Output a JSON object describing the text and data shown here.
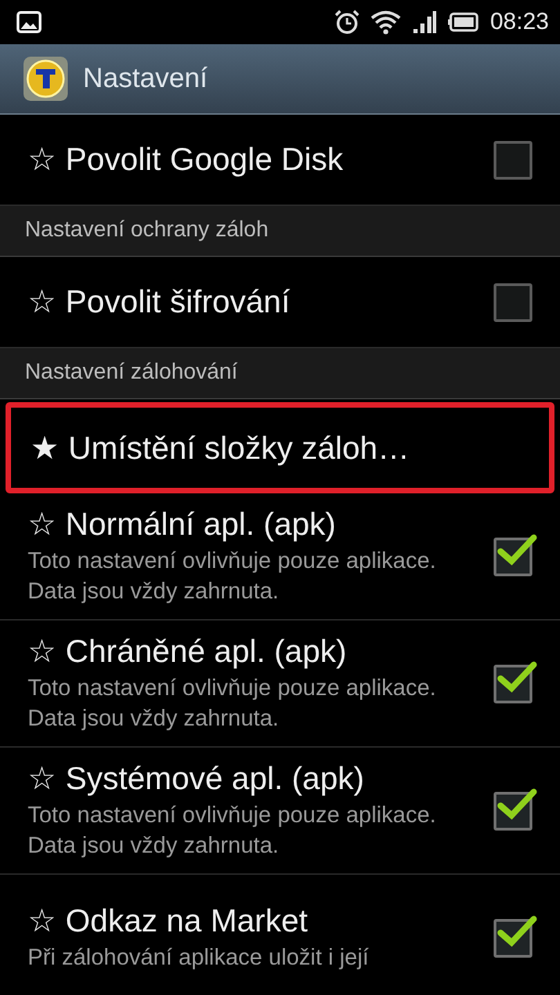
{
  "status_bar": {
    "time": "08:23"
  },
  "action_bar": {
    "title": "Nastavení"
  },
  "items": [
    {
      "kind": "toggle",
      "title": "☆ Povolit Google Disk",
      "highlighted": false,
      "checked": false
    },
    {
      "kind": "category",
      "title": "Nastavení ochrany záloh"
    },
    {
      "kind": "toggle",
      "title": "☆ Povolit šifrování",
      "highlighted": false,
      "checked": false
    },
    {
      "kind": "category",
      "title": "Nastavení zálohování"
    },
    {
      "kind": "link",
      "title": "★ Umístění složky záloh…",
      "highlighted": true
    },
    {
      "kind": "toggle",
      "title": "☆ Normální apl. (apk)",
      "summary": "Toto nastavení ovlivňuje pouze aplikace. Data jsou vždy zahrnuta.",
      "highlighted": false,
      "checked": true
    },
    {
      "kind": "toggle",
      "title": "☆ Chráněné apl. (apk)",
      "summary": "Toto nastavení ovlivňuje pouze aplikace. Data jsou vždy zahrnuta.",
      "highlighted": false,
      "checked": true
    },
    {
      "kind": "toggle",
      "title": "☆ Systémové apl. (apk)",
      "summary": "Toto nastavení ovlivňuje pouze aplikace. Data jsou vždy zahrnuta.",
      "highlighted": false,
      "checked": true
    },
    {
      "kind": "toggle",
      "title": "☆ Odkaz na Market",
      "summary": "Při zálohování aplikace uložit i její",
      "highlighted": false,
      "checked": true
    }
  ]
}
